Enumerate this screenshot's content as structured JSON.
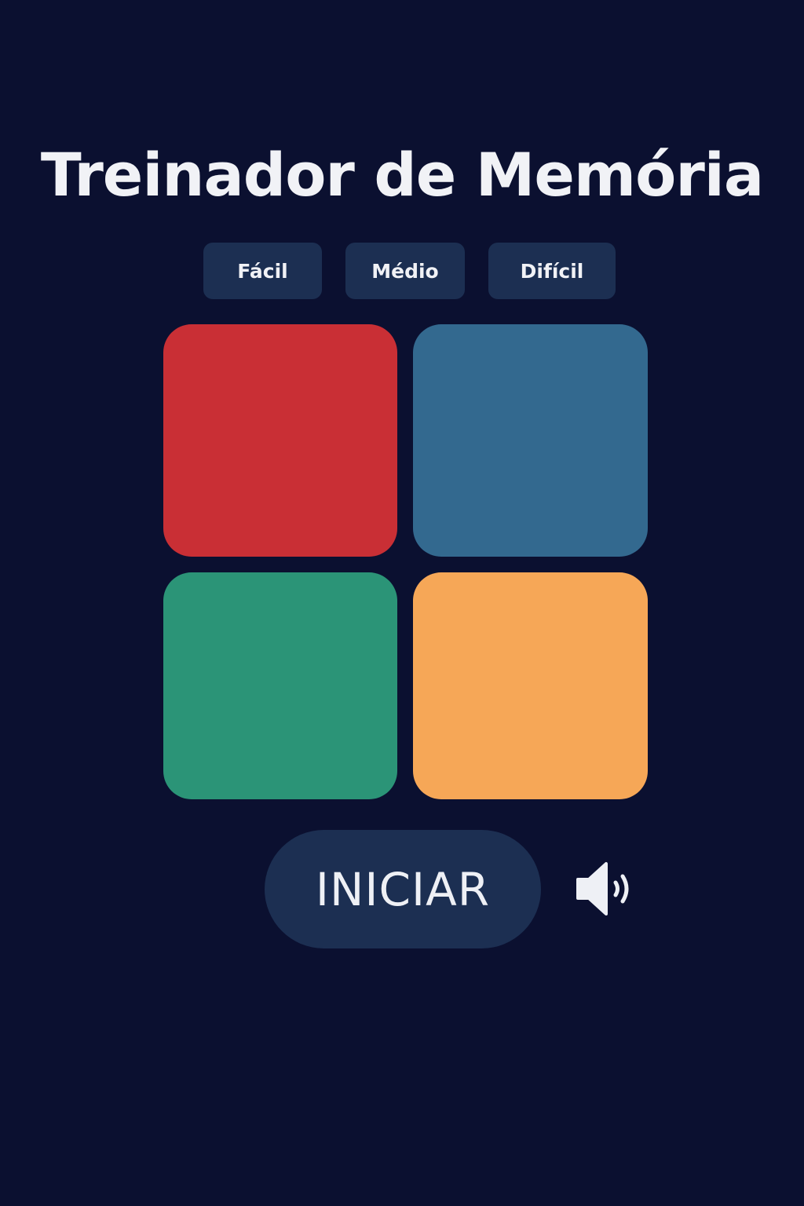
{
  "title": "Treinador de Memória",
  "difficulty": {
    "options": [
      "Fácil",
      "Médio",
      "Difícil"
    ]
  },
  "pads": [
    {
      "name": "red",
      "color": "#c92f35"
    },
    {
      "name": "blue",
      "color": "#33698f"
    },
    {
      "name": "green",
      "color": "#2b9477"
    },
    {
      "name": "orange",
      "color": "#f6a757"
    }
  ],
  "start_button": {
    "label": "INICIAR"
  },
  "sound_toggle": {
    "icon": "speaker-icon"
  },
  "colors": {
    "background": "#0b1030",
    "button": "#1c2f52",
    "text": "#f1f2f6"
  }
}
